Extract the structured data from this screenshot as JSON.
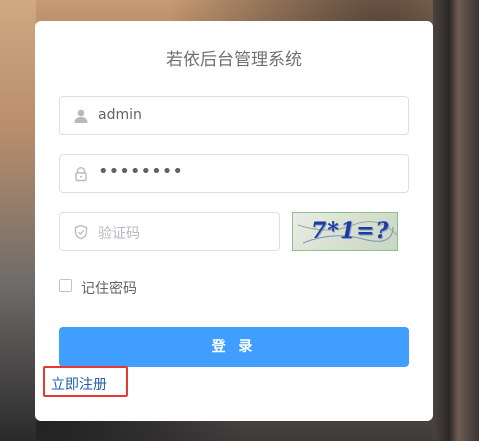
{
  "app": {
    "title": "若依后台管理系统"
  },
  "login_form": {
    "username": {
      "value": "admin",
      "icon": "user-icon"
    },
    "password": {
      "value": "••••••••",
      "icon": "lock-icon"
    },
    "code": {
      "placeholder": "验证码",
      "icon": "shield-check-icon"
    },
    "captcha": {
      "text": "7*1=?"
    },
    "remember_label": "记住密码",
    "submit_label": "登 录",
    "register_link": "立即注册"
  },
  "colors": {
    "primary": "#409eff",
    "highlight_box": "#e53935",
    "link": "#1f5ea8"
  }
}
